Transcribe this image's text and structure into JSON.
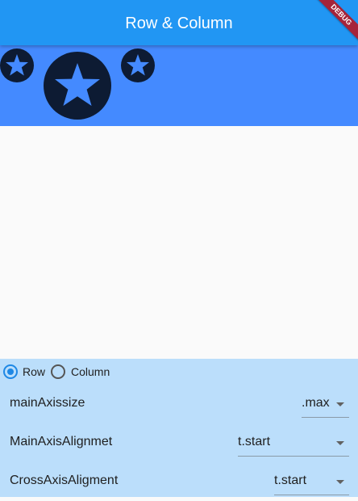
{
  "appbar": {
    "title": "Row & Column"
  },
  "debug_banner": {
    "label": "DEBUG"
  },
  "stage": {
    "background": "#448aff",
    "icons": [
      "star-icon",
      "star-icon",
      "star-icon"
    ]
  },
  "layout_mode": {
    "options": [
      {
        "label": "Row",
        "selected": true
      },
      {
        "label": "Column",
        "selected": false
      }
    ]
  },
  "settings": [
    {
      "label": "mainAxissize",
      "value": ".max"
    },
    {
      "label": "MainAxisAlignmet",
      "value": "t.start"
    },
    {
      "label": "CrossAxisAligment",
      "value": "t.start"
    }
  ],
  "colors": {
    "appbar": "#2196f3",
    "controls_bg": "#bbdefb",
    "accent": "#1e88e5",
    "debug": "#a5243a"
  }
}
